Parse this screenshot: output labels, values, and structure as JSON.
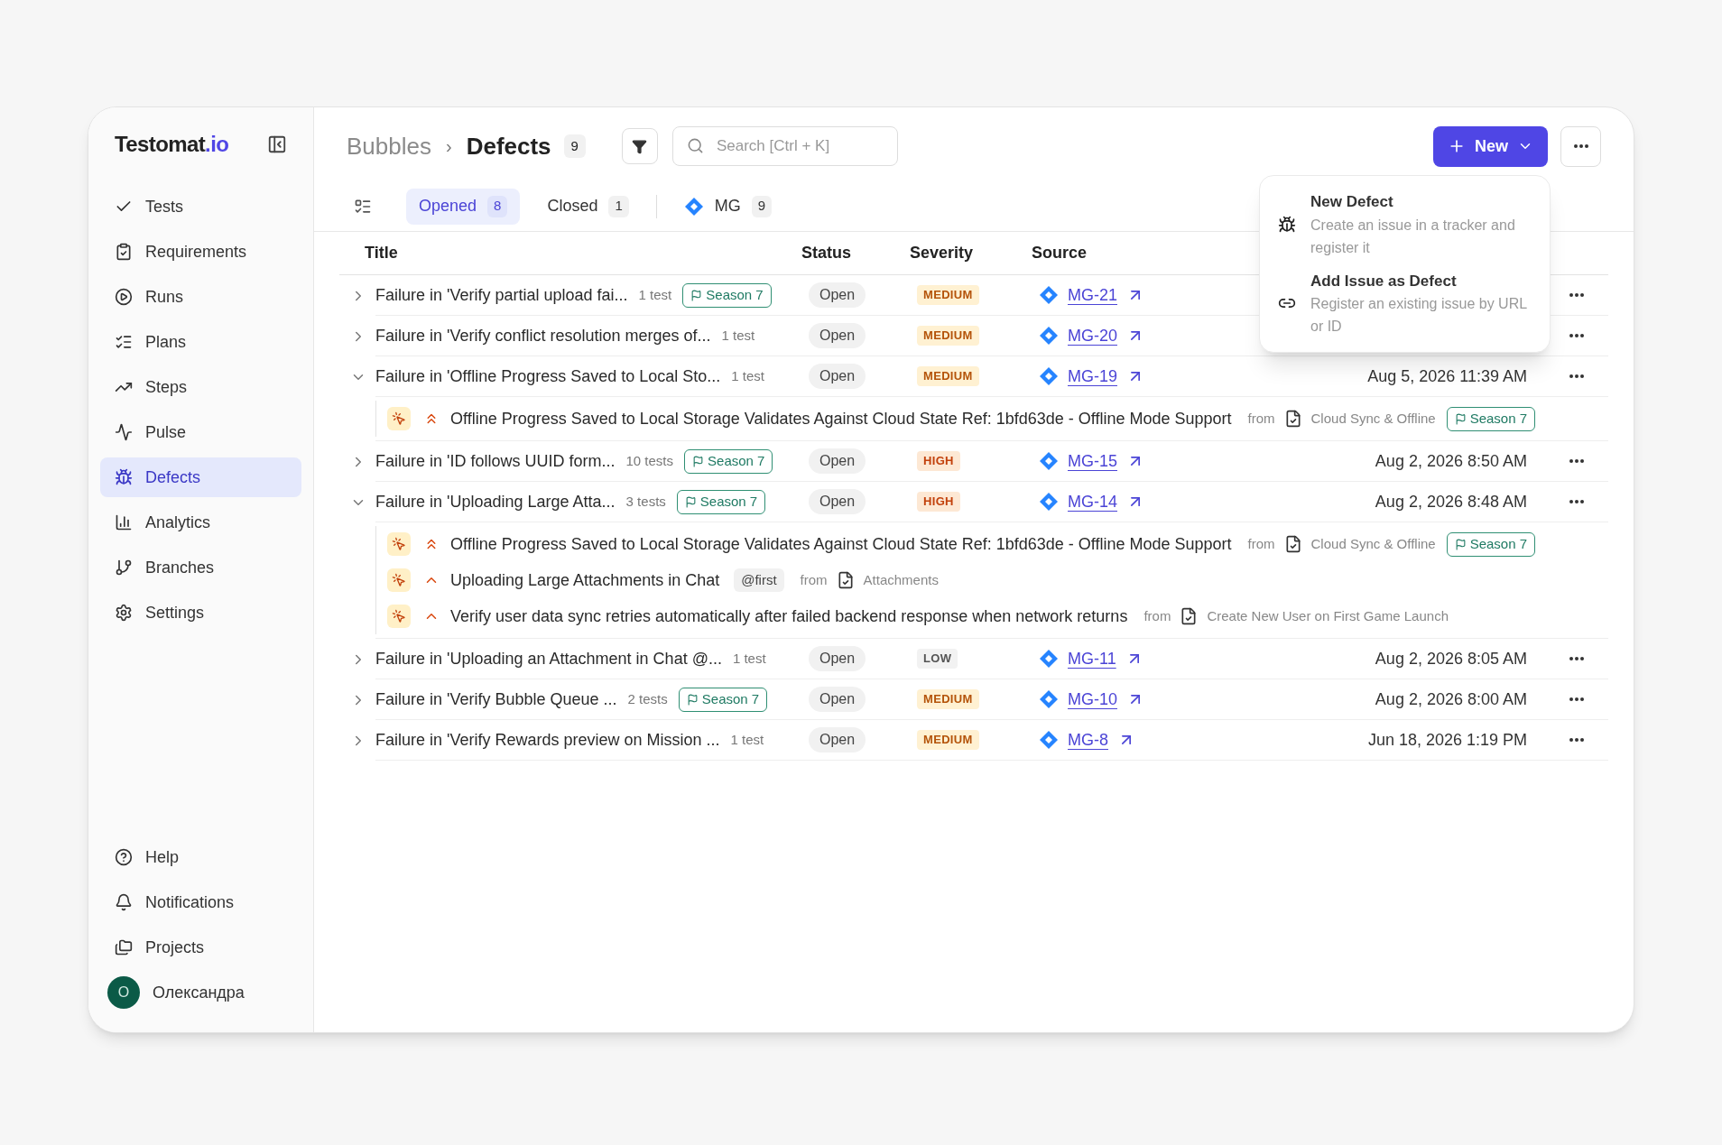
{
  "sidebar": {
    "logo": {
      "name": "Testomat",
      "suffix": ".io"
    },
    "items": [
      {
        "label": "Tests",
        "selected": false
      },
      {
        "label": "Requirements",
        "selected": false
      },
      {
        "label": "Runs",
        "selected": false
      },
      {
        "label": "Plans",
        "selected": false
      },
      {
        "label": "Steps",
        "selected": false
      },
      {
        "label": "Pulse",
        "selected": false
      },
      {
        "label": "Defects",
        "selected": true
      },
      {
        "label": "Analytics",
        "selected": false
      },
      {
        "label": "Branches",
        "selected": false
      },
      {
        "label": "Settings",
        "selected": false
      }
    ],
    "bottom_items": [
      {
        "label": "Help"
      },
      {
        "label": "Notifications"
      },
      {
        "label": "Projects"
      }
    ],
    "user": {
      "initial": "О",
      "name": "Олександра"
    }
  },
  "header": {
    "breadcrumb": [
      "Bubbles",
      "›"
    ],
    "title": "Defects",
    "count": "9",
    "search": {
      "placeholder": "Search [Ctrl + K]"
    },
    "new_button": "New"
  },
  "tabs": [
    {
      "label": "Opened",
      "count": "8",
      "selected": true
    },
    {
      "label": "Closed",
      "count": "1",
      "selected": false
    },
    {
      "label": "MG",
      "count": "9",
      "selected": false,
      "kind": "tracker"
    }
  ],
  "table": {
    "columns": [
      "Title",
      "Status",
      "Severity",
      "Source"
    ],
    "rows": [
      {
        "title": "Failure in 'Verify partial upload fai...",
        "tests": "1 test",
        "tag": "Season 7",
        "status": "Open",
        "severity": "MEDIUM",
        "source": "MG-21",
        "expanded": false
      },
      {
        "title": "Failure in 'Verify conflict resolution merges of...",
        "tests": "1 test",
        "status": "Open",
        "severity": "MEDIUM",
        "source": "MG-20",
        "expanded": false
      },
      {
        "title": "Failure in 'Offline Progress Saved to Local Sto...",
        "tests": "1 test",
        "status": "Open",
        "severity": "MEDIUM",
        "source": "MG-19",
        "date": "Aug 5, 2026 11:39 AM",
        "expanded": true,
        "children": [
          {
            "kind": "high",
            "title": "Offline Progress Saved to Local Storage Validates Against Cloud State Ref: 1bfd63de - Offline Mode Support",
            "from": "from",
            "file": "Cloud Sync & Offline",
            "tag": "Season 7"
          }
        ]
      },
      {
        "title": "Failure in 'ID follows UUID form...",
        "tests": "10 tests",
        "tag": "Season 7",
        "status": "Open",
        "severity": "HIGH",
        "source": "MG-15",
        "date": "Aug 2, 2026 8:50 AM",
        "expanded": false
      },
      {
        "title": "Failure in 'Uploading Large Atta...",
        "tests": "3 tests",
        "tag": "Season 7",
        "status": "Open",
        "severity": "HIGH",
        "source": "MG-14",
        "date": "Aug 2, 2026 8:48 AM",
        "expanded": true,
        "children": [
          {
            "kind": "high",
            "title": "Offline Progress Saved to Local Storage Validates Against Cloud State Ref: 1bfd63de - Offline Mode Support",
            "from": "from",
            "file": "Cloud Sync & Offline",
            "tag": "Season 7"
          },
          {
            "kind": "normal",
            "title": "Uploading Large Attachments in Chat",
            "label": "@first",
            "from": "from",
            "file": "Attachments"
          },
          {
            "kind": "normal",
            "title": "Verify user data sync retries automatically after failed backend response when network returns",
            "from": "from",
            "file": "Create New User on First Game Launch"
          }
        ]
      },
      {
        "title": "Failure in 'Uploading an Attachment in Chat @...",
        "tests": "1 test",
        "status": "Open",
        "severity": "LOW",
        "source": "MG-11",
        "date": "Aug 2, 2026 8:05 AM",
        "expanded": false
      },
      {
        "title": "Failure in 'Verify Bubble Queue ...",
        "tests": "2 tests",
        "tag": "Season 7",
        "status": "Open",
        "severity": "MEDIUM",
        "source": "MG-10",
        "date": "Aug 2, 2026 8:00 AM",
        "expanded": false
      },
      {
        "title": "Failure in 'Verify Rewards preview on Mission ...",
        "tests": "1 test",
        "status": "Open",
        "severity": "MEDIUM",
        "source": "MG-8",
        "date": "Jun 18, 2026 1:19 PM",
        "expanded": false
      }
    ]
  },
  "menu": {
    "items": [
      {
        "title": "New Defect",
        "description": "Create an issue in a tracker and register it"
      },
      {
        "title": "Add Issue as Defect",
        "description": "Register an existing issue by URL or ID"
      }
    ]
  }
}
